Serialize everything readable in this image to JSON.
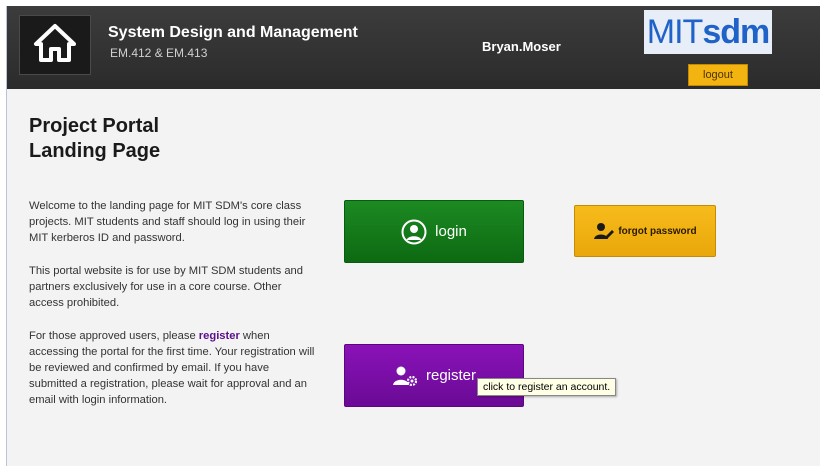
{
  "header": {
    "title": "System Design and Management",
    "subtitle": "EM.412 & EM.413",
    "user_name": "Bryan.Moser",
    "logo": {
      "part1": "MIT",
      "part2": "sdm"
    },
    "logout_label": "logout",
    "home_icon": "home-icon"
  },
  "main": {
    "title_line1": "Project Portal",
    "title_line2": "Landing Page",
    "para1": "Welcome to the landing page for MIT SDM's core class projects. MIT students and staff should log in using their MIT kerberos ID and password.",
    "para2": "This portal website is for use by MIT SDM students and partners exclusively for use in a core course. Other access prohibited.",
    "para3_before": "For those approved users, please ",
    "para3_link": "register",
    "para3_after": " when accessing the portal for the first time.  Your registration will be reviewed and confirmed by email. If you have submitted a registration, please wait for approval and an email with login information."
  },
  "buttons": {
    "login_label": "login",
    "forgot_label": "forgot password",
    "register_label": "register"
  },
  "tooltip": "click to register an account.",
  "colors": {
    "header": "#333333",
    "login": "#137a1a",
    "forgot": "#f0b114",
    "register": "#7a0fa8",
    "logout": "#f3b411"
  }
}
